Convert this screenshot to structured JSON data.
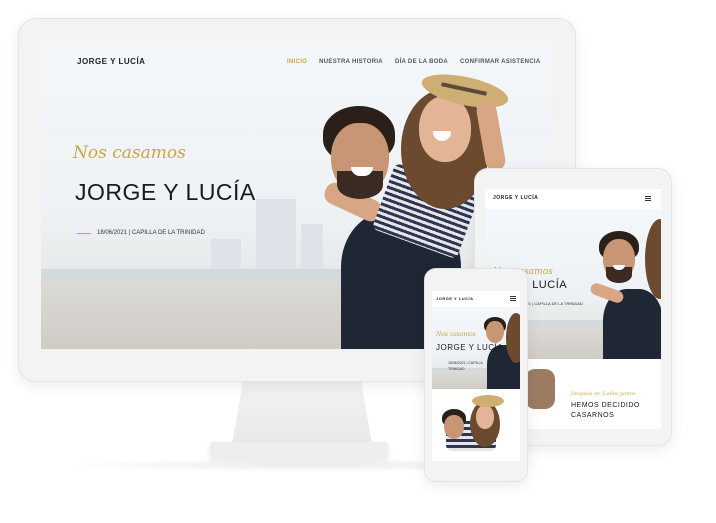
{
  "site": {
    "brand": "JORGE Y LUCÍA",
    "nav": [
      {
        "label": "INICIO",
        "active": true
      },
      {
        "label": "NUESTRA HISTORIA",
        "active": false
      },
      {
        "label": "DÍA DE LA BODA",
        "active": false
      },
      {
        "label": "CONFIRMAR ASISTENCIA",
        "active": false
      }
    ],
    "hero": {
      "script": "Nos casamos",
      "headline": "JORGE Y LUCÍA",
      "date_desktop": "18/06/2021 | CAPILLA DE LA TRINIDAD",
      "date_tablet": "/2021 | CAPILLA DE LA TRINIDAD",
      "date_phone_line1": "18/06/2021 | CAPILLA",
      "date_phone_line2": "TRINIDAD"
    },
    "section2": {
      "script": "Después de 5 años juntos",
      "title_line1": "HEMOS DECIDIDO",
      "title_line2": "CASARNOS"
    }
  },
  "tablet": {
    "brand": "JORGE Y LUCÍA",
    "script": "Nos casamos",
    "headline": "Y LUCÍA"
  },
  "phone": {
    "brand": "JORGE Y LUCÍA",
    "script": "Nos casamos",
    "headline": "JORGE Y LUCÍA"
  },
  "colors": {
    "accent": "#c9a54a",
    "text": "#1a1a1a"
  }
}
